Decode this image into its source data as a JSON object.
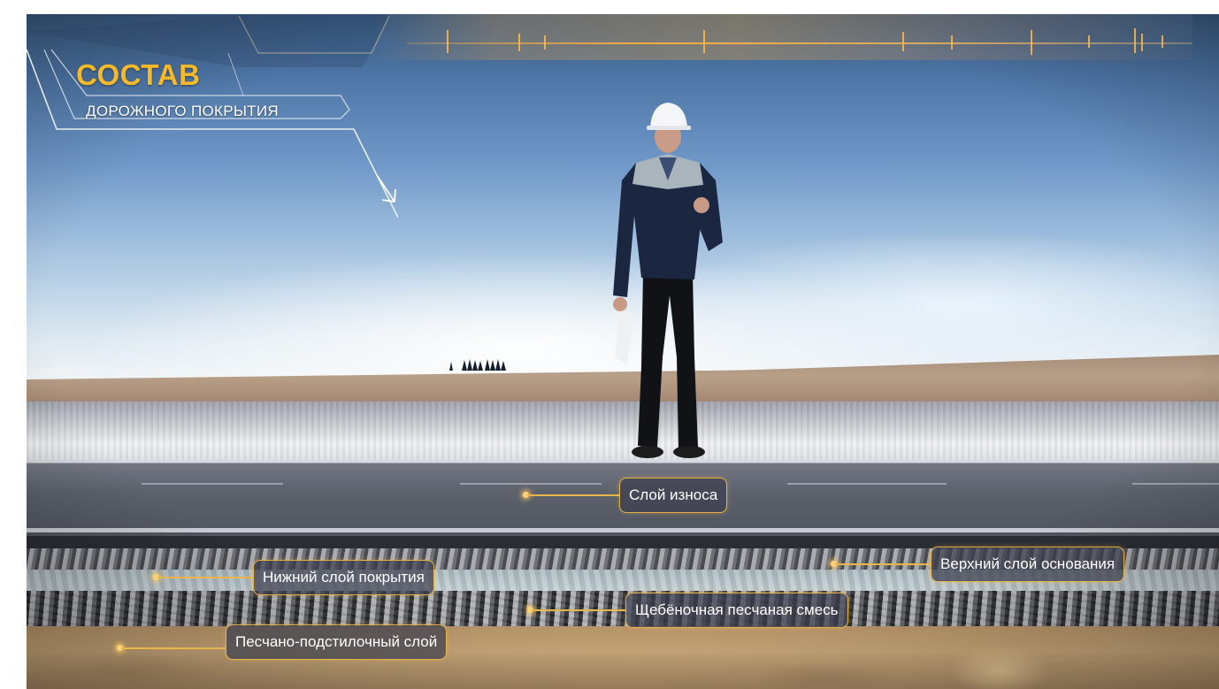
{
  "title": {
    "main": "СОСТАВ",
    "sub": "ДОРОЖНОГО ПОКРЫТИЯ"
  },
  "layers": [
    {
      "label": "Слой износа"
    },
    {
      "label": "Верхний слой основания"
    },
    {
      "label": "Нижний слой покрытия"
    },
    {
      "label": "Щебёночная песчаная смесь"
    },
    {
      "label": "Песчано-подстилочный слой"
    }
  ],
  "colors": {
    "accent": "#f5b92a",
    "label_border": "#e6b24a",
    "label_bg": "#3c3e4e"
  },
  "icons": [
    "arrow-down-right-icon"
  ]
}
